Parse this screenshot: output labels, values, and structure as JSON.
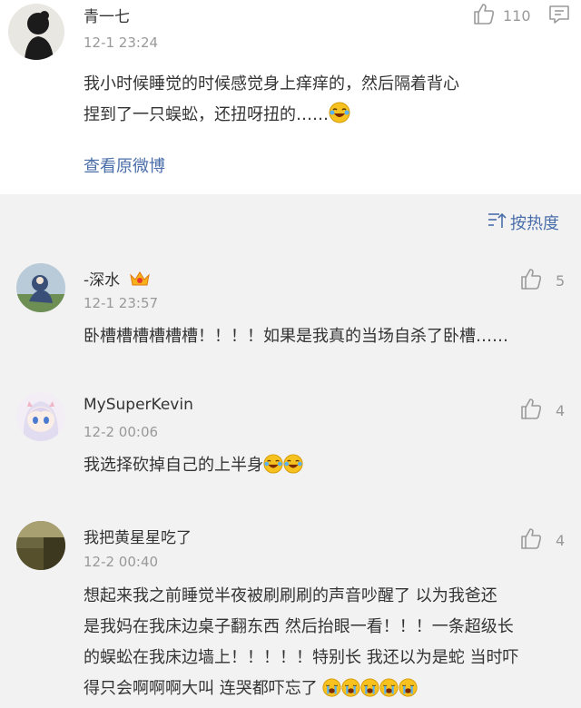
{
  "top_comment": {
    "username": "青一七",
    "time": "12-1 23:24",
    "likes": "110",
    "text_line1": "我小时候睡觉的时候感觉身上痒痒的，然后隔着背心",
    "text_line2": "捏到了一只蜈蚣，还扭呀扭的……",
    "view_original": "查看原微博"
  },
  "sort": {
    "label": "按热度"
  },
  "replies": [
    {
      "username": "-深水",
      "time": "12-1 23:57",
      "likes": "5",
      "text": "卧槽槽槽槽槽槽！！！！如果是我真的当场自杀了卧槽……"
    },
    {
      "username": "MySuperKevin",
      "time": "12-2 00:06",
      "likes": "4",
      "text": "我选择砍掉自己的上半身"
    },
    {
      "username": "我把黄星星吃了",
      "time": "12-2 00:40",
      "likes": "4",
      "lines": [
        "想起来我之前睡觉半夜被刷刷刷的声音吵醒了 以为我爸还",
        "是我妈在我床边桌子翻东西 然后抬眼一看！！！一条超级长",
        "的蜈蚣在我床边墙上！！！！！特别长 我还以为是蛇 当时吓",
        "得只会啊啊啊大叫 连哭都吓忘了"
      ]
    }
  ],
  "icons": {
    "like": "thumbs-up-icon",
    "comment": "comment-icon",
    "sort": "sort-icon",
    "laugh_cry": "laugh-cry-emoji",
    "crying": "crying-emoji",
    "crown": "crown-badge-icon"
  },
  "colors": {
    "link": "#4a6ea9",
    "meta": "#999999",
    "text": "#333333",
    "background": "#f2f2f2"
  }
}
